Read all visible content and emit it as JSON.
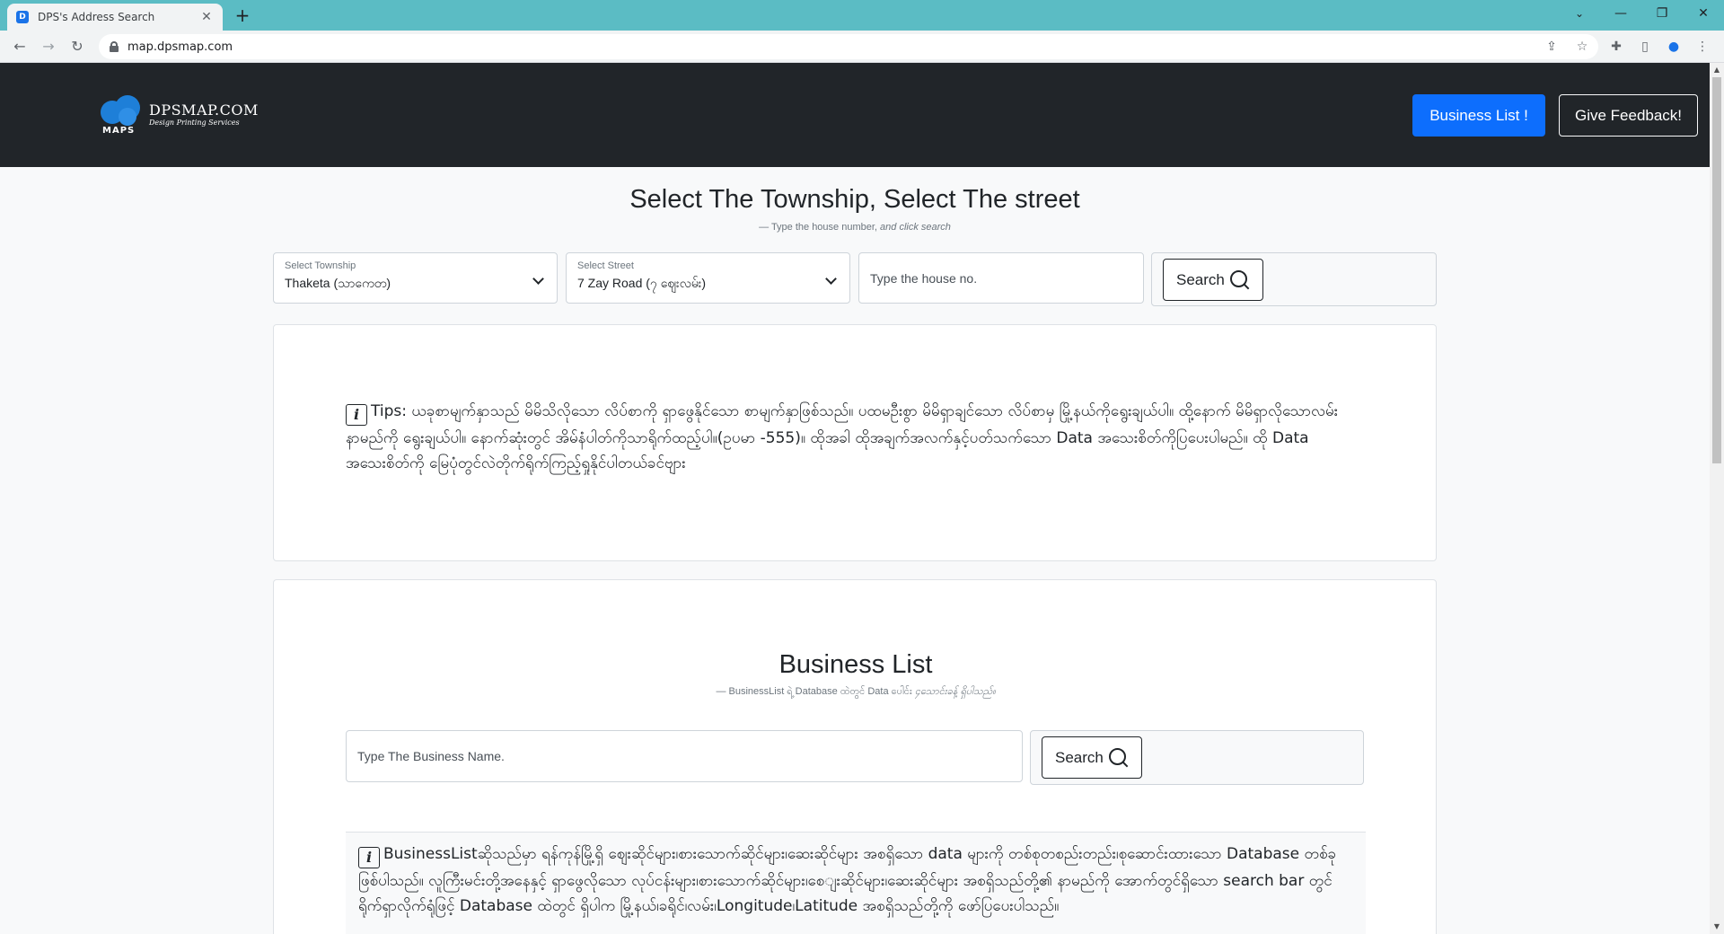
{
  "browser": {
    "tab_title": "DPS's Address Search",
    "tab_close": "✕",
    "new_tab": "+",
    "url": "map.dpsmap.com",
    "back": "←",
    "forward": "→",
    "reload": "↻",
    "minimize": "—",
    "maximize": "❐",
    "close": "✕",
    "tab_search": "⌄",
    "share": "⇪",
    "bookmark": "☆",
    "extensions": "✚",
    "sidepanel": "▯",
    "menu": "⋮"
  },
  "header": {
    "logo_name": "DPSMAP.COM",
    "logo_sub": "Design Printing Services",
    "logo_maps": "MAPS",
    "business_list_button": "Business List !",
    "feedback_button": "Give Feedback!"
  },
  "address_search": {
    "title": "Select The Township, Select The street",
    "subtitle_dash": "— ",
    "subtitle_plain": "Type the house number,",
    "subtitle_italic": "and click search",
    "township_label": "Select Township",
    "township_value": "Thaketa (သာကေတ)",
    "street_label": "Select Street",
    "street_value": "7 Zay Road (၇ ဈေးလမ်း)",
    "house_placeholder": "Type the house no.",
    "search_button": "Search"
  },
  "tips": {
    "icon": "i",
    "text": "Tips: ယခုစာမျက်နှာသည် မိမိသိလိုသော လိပ်စာကို ရှာဖွေနိုင်သော စာမျက်နှာဖြစ်သည်။ ပထမဦးစွာ မိမိရှာချင်သော လိပ်စာမှ မြို့နယ်ကိုရွေးချယ်ပါ။ ထို့နောက် မိမိရှာလိုသောလမ်းနာမည်ကို ရွေးချယ်ပါ။ နောက်ဆုံးတွင် အိမ်နံပါတ်ကိုသာရိုက်ထည့်ပါ။(ဥပမာ -555)။ ထိုအခါ ထိုအချက်အလက်နှင့်ပတ်သက်သော Data အသေးစိတ်ကိုပြပေးပါမည်။ ထို Data အသေးစိတ်ကို မြေပုံတွင်လဲတိုက်ရိုက်ကြည့်ရှုနိုင်ပါတယ်ခင်ဗျား"
  },
  "business": {
    "title": "Business List",
    "subtitle_dash": "— ",
    "subtitle_plain": "BusinessList ရဲ့ Database ထဲတွင် Data ပေါင်း",
    "subtitle_italic": "၄သောင်းခန့် ရှိပါသည်။",
    "search_placeholder": "Type The Business Name.",
    "search_button": "Search",
    "info_icon": "i",
    "info_text": "BusinessListဆိုသည်မှာ ရန်ကုန်မြို့ရှိ ဈေးဆိုင်များ၊စားသောက်ဆိုင်များ၊ဆေးဆိုင်များ အစရှိသော data များကို တစ်စုတစည်းတည်း၊စုဆောင်းထားသော Database တစ်ခုဖြစ်ပါသည်။ လူကြီးမင်းတို့အနေနှင့် ရှာဖွေလိုသော လုပ်ငန်းများ၊စားသောက်ဆိုင်များ၊စေျးဆိုင်များ၊ဆေးဆိုင်များ အစရှိသည်တို့၏ နာမည်ကို အောက်တွင်ရှိသော search bar တွင် ရိုက်ရှာလိုက်ရုံဖြင့် Database ထဲတွင် ရှိပါက မြို့နယ်၊ခရိုင်၊လမ်း၊Longitude၊Latitude အစရှိသည်တို့ကို ဖော်ပြပေးပါသည်။"
  }
}
